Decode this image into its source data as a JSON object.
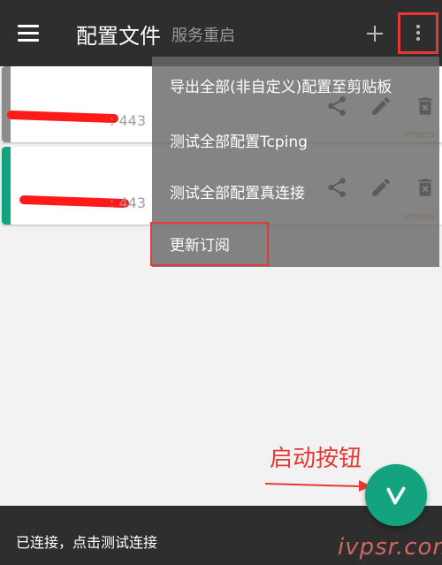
{
  "appbar": {
    "title": "配置文件",
    "subtitle": "服务重启",
    "menu_icon": "hamburger-menu-icon",
    "add_icon": "plus-icon",
    "more_icon": "more-vert-icon"
  },
  "servers": [
    {
      "port": ": 443",
      "protocol": "vmess",
      "indicator_color": "#8c8c8c"
    },
    {
      "port": ": 443",
      "protocol": "vmess",
      "indicator_color": "#14a37f"
    }
  ],
  "card_icons": [
    "share-icon",
    "edit-icon",
    "delete-icon"
  ],
  "dropdown_menu": {
    "items": [
      "导出全部(非自定义)配置至剪贴板",
      "测试全部配置Tcping",
      "测试全部配置真连接",
      "更新订阅"
    ]
  },
  "annotation": {
    "label": "启动按钮"
  },
  "status_bar": {
    "text": "已连接，点击测试连接"
  },
  "fab": {
    "icon": "v-icon"
  },
  "watermark": {
    "text": "ivpsr.com"
  },
  "colors": {
    "appbar": "#2e2e2e",
    "accent_green": "#14a37f",
    "highlight_red": "#e53935",
    "protocol_orange": "#e08a2e"
  }
}
